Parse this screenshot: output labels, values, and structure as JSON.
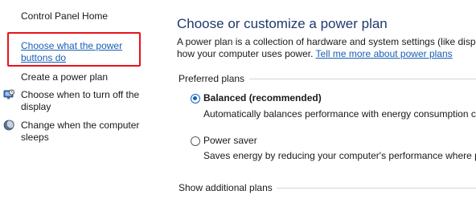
{
  "sidebar": {
    "home": "Control Panel Home",
    "items": [
      {
        "label": "Choose what the power buttons do",
        "icon": "none",
        "highlighted": true
      },
      {
        "label": "Create a power plan",
        "icon": "none"
      },
      {
        "label": "Choose when to turn off the display",
        "icon": "monitor-icon"
      },
      {
        "label": "Change when the computer sleeps",
        "icon": "moon-icon"
      }
    ]
  },
  "main": {
    "title": "Choose or customize a power plan",
    "description_line1": "A power plan is a collection of hardware and system settings (like displ",
    "description_line2_prefix": "how your computer uses power. ",
    "description_link": "Tell me more about power plans",
    "preferred_plans_label": "Preferred plans",
    "plans": [
      {
        "name": "Balanced (recommended)",
        "selected": true,
        "description": "Automatically balances performance with energy consumption c"
      },
      {
        "name": "Power saver",
        "selected": false,
        "description": "Saves energy by reducing your computer's performance where p"
      }
    ],
    "additional_plans_label": "Show additional plans"
  },
  "colors": {
    "link": "#1a5fb4",
    "title": "#1e3a6e",
    "highlight_border": "#e8121b",
    "radio_selected": "#0a62c4"
  }
}
